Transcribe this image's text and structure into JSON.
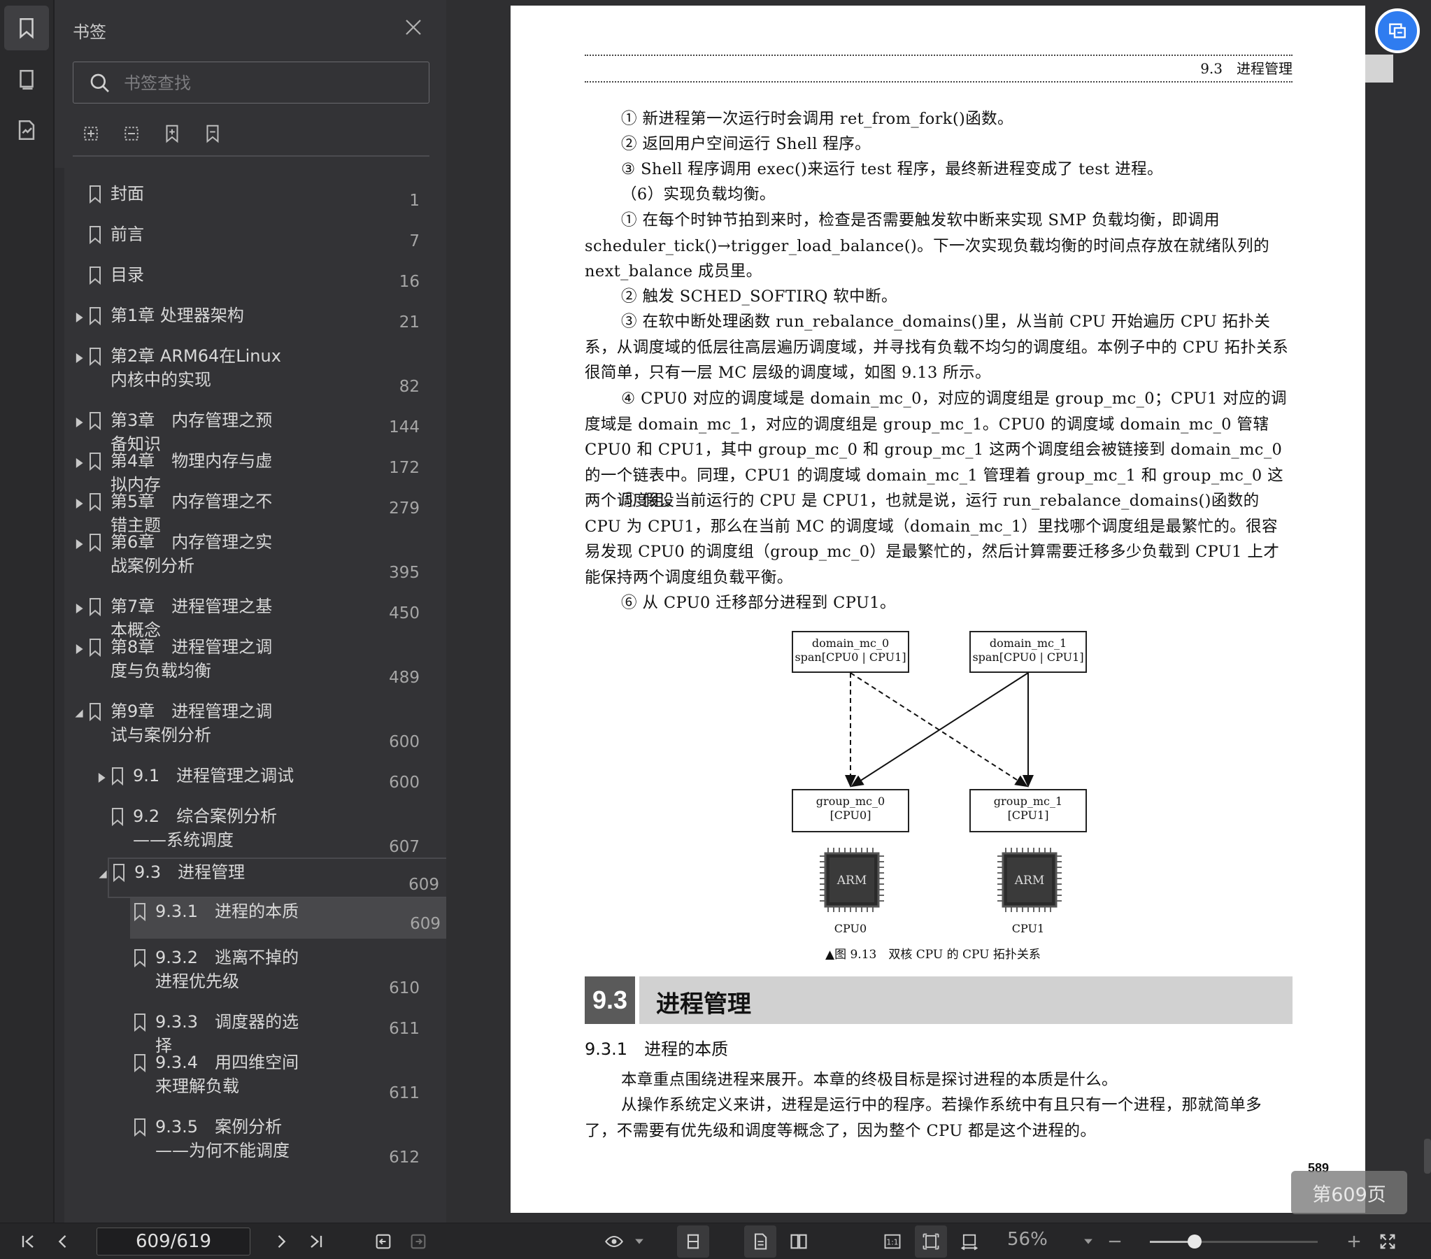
{
  "sidebar": {
    "title": "书签",
    "search_placeholder": "书签查找",
    "bookmarks": [
      {
        "label": "封面",
        "page": "1"
      },
      {
        "label": "前言",
        "page": "7"
      },
      {
        "label": "目录",
        "page": "16"
      },
      {
        "label": "第1章 处理器架构",
        "page": "21"
      },
      {
        "label": "第2章 ARM64在Linux内核中的实现",
        "page": "82"
      },
      {
        "label": "第3章　内存管理之预备知识",
        "page": "144"
      },
      {
        "label": "第4章　物理内存与虚拟内存",
        "page": "172"
      },
      {
        "label": "第5章　内存管理之不错主题",
        "page": "279"
      },
      {
        "label": "第6章　内存管理之实战案例分析",
        "page": "395"
      },
      {
        "label": "第7章　进程管理之基本概念",
        "page": "450"
      },
      {
        "label": "第8章　进程管理之调度与负载均衡",
        "page": "489"
      },
      {
        "label": "第9章　进程管理之调试与案例分析",
        "page": "600"
      },
      {
        "label": "9.1　进程管理之调试",
        "page": "600"
      },
      {
        "label": "9.2　综合案例分析——系统调度",
        "page": "607"
      },
      {
        "label": "9.3　进程管理",
        "page": "609"
      },
      {
        "label": "9.3.1　进程的本质",
        "page": "609"
      },
      {
        "label": "9.3.2　逃离不掉的进程优先级",
        "page": "610"
      },
      {
        "label": "9.3.3　调度器的选择",
        "page": "611"
      },
      {
        "label": "9.3.4　用四维空间来理解负载",
        "page": "611"
      },
      {
        "label": "9.3.5　案例分析——为何不能调度",
        "page": "612"
      }
    ]
  },
  "document": {
    "running_head": "9.3　进程管理",
    "paragraphs": [
      "① 新进程第一次运行时会调用 ret_from_fork()函数。",
      "② 返回用户空间运行 Shell 程序。",
      "③ Shell 程序调用 exec()来运行 test 程序，最终新进程变成了 test 进程。",
      "（6）实现负载均衡。",
      "① 在每个时钟节拍到来时，检查是否需要触发软中断来实现 SMP 负载均衡，即调用 scheduler_tick()→trigger_load_balance()。下一次实现负载均衡的时间点存放在就绪队列的 next_balance 成员里。",
      "② 触发 SCHED_SOFTIRQ 软中断。",
      "③ 在软中断处理函数 run_rebalance_domains()里，从当前 CPU 开始遍历 CPU 拓扑关系，从调度域的低层往高层遍历调度域，并寻找有负载不均匀的调度组。本例子中的 CPU 拓扑关系很简单，只有一层 MC 层级的调度域，如图 9.13 所示。",
      "④ CPU0 对应的调度域是 domain_mc_0，对应的调度组是 group_mc_0；CPU1 对应的调度域是 domain_mc_1，对应的调度组是 group_mc_1。CPU0 的调度域 domain_mc_0 管辖 CPU0 和 CPU1，其中 group_mc_0 和 group_mc_1 这两个调度组会被链接到 domain_mc_0 的一个链表中。同理，CPU1 的调度域 domain_mc_1 管理着 group_mc_1 和 group_mc_0 这两个调度组。",
      "⑤ 假设当前运行的 CPU 是 CPU1，也就是说，运行 run_rebalance_domains()函数的 CPU 为 CPU1，那么在当前 MC 的调度域（domain_mc_1）里找哪个调度组是最繁忙的。很容易发现 CPU0 的调度组（group_mc_0）是最繁忙的，然后计算需要迁移多少负载到 CPU1 上才能保持两个调度组负载平衡。",
      "⑥ 从 CPU0 迁移部分进程到 CPU1。"
    ],
    "figure": {
      "domain0_line1": "domain_mc_0",
      "domain0_line2": "span[CPU0 | CPU1]",
      "domain1_line1": "domain_mc_1",
      "domain1_line2": "span[CPU0 | CPU1]",
      "group0_line1": "group_mc_0",
      "group0_line2": "[CPU0]",
      "group1_line1": "group_mc_1",
      "group1_line2": "[CPU1]",
      "chip_text": "ARM",
      "cpu0": "CPU0",
      "cpu1": "CPU1",
      "caption": "▲图 9.13　双核 CPU 的 CPU 拓扑关系"
    },
    "section_number": "9.3",
    "section_title": "进程管理",
    "subsection": "9.3.1　进程的本质",
    "body": [
      "本章重点围绕进程来展开。本章的终极目标是探讨进程的本质是什么。",
      "从操作系统定义来讲，进程是运行中的程序。若操作系统中有且只有一个进程，那就简单多了，不需要有优先级和调度等概念了，因为整个 CPU 都是这个进程的。"
    ],
    "page_number": "589",
    "page_toast": "第609页"
  },
  "toolbar": {
    "page_indicator": "609/619",
    "zoom": "56%",
    "zoom_fraction": 0.27
  }
}
